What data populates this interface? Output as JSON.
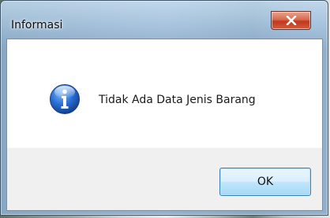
{
  "window": {
    "title": "Informasi"
  },
  "dialog": {
    "icon": "information-icon",
    "message": "Tidak Ada Data Jenis Barang",
    "ok_label": "OK"
  },
  "colors": {
    "close_button": "#c0391f",
    "ok_button_border": "#3c7fb1",
    "info_icon": "#1d5fc4"
  }
}
